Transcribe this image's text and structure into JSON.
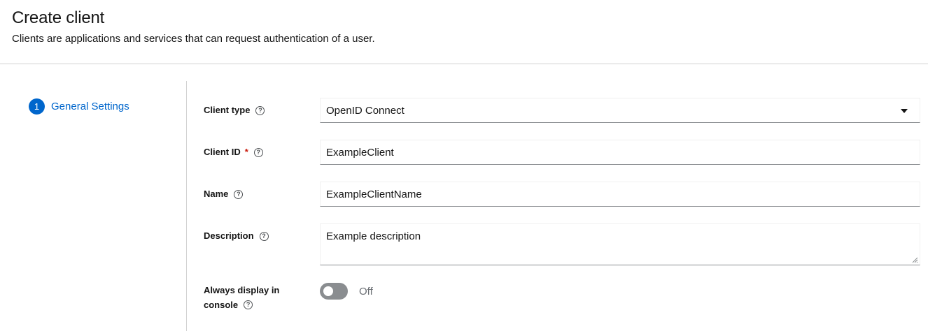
{
  "header": {
    "title": "Create client",
    "subtitle": "Clients are applications and services that can request authentication of a user."
  },
  "wizard": {
    "steps": [
      {
        "number": "1",
        "label": "General Settings"
      }
    ]
  },
  "form": {
    "client_type": {
      "label": "Client type",
      "value": "OpenID Connect"
    },
    "client_id": {
      "label": "Client ID",
      "required_mark": "*",
      "value": "ExampleClient"
    },
    "name": {
      "label": "Name",
      "value": "ExampleClientName"
    },
    "description": {
      "label": "Description",
      "value": "Example description"
    },
    "always_display": {
      "label_line1": "Always display in",
      "label_line2": "console",
      "state": "Off"
    },
    "help_glyph": "?"
  },
  "colors": {
    "accent": "#0066cc",
    "required": "#c9190b",
    "toggle_off": "#8a8d90"
  },
  "icons": {
    "help": "help-circle-icon",
    "caret": "caret-down-icon",
    "resize": "resize-grip-icon"
  }
}
